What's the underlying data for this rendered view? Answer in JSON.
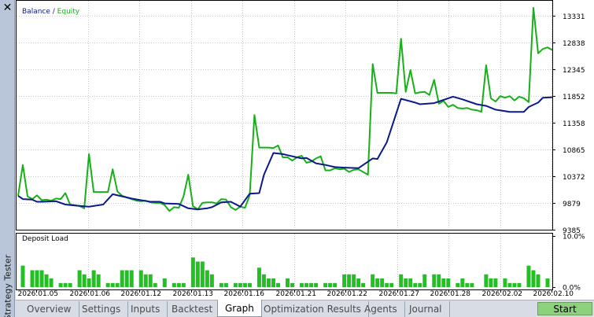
{
  "window": {
    "close_glyph": "✕",
    "side_title": "Strategy Tester"
  },
  "legend": {
    "balance": "Balance",
    "separator": " / ",
    "equity": "Equity"
  },
  "subchart_label": "Deposit Load",
  "tabs": [
    {
      "label": "Overview",
      "active": false
    },
    {
      "label": "Settings",
      "active": false
    },
    {
      "label": "Inputs",
      "active": false
    },
    {
      "label": "Backtest",
      "active": false
    },
    {
      "label": "Graph",
      "active": true
    },
    {
      "label": "Optimization Results",
      "active": false
    },
    {
      "label": "Agents",
      "active": false
    },
    {
      "label": "Journal",
      "active": false
    }
  ],
  "start_label": "Start",
  "colors": {
    "balance": "#0a1a8c",
    "equity": "#18b018",
    "deposit_load": "#22c022",
    "grid": "#c8c8c8"
  },
  "chart_data": {
    "type": "line",
    "ylim": [
      9385,
      13580
    ],
    "y_ticks": [
      9385,
      9879,
      10372,
      10865,
      11358,
      11852,
      12345,
      12838,
      13331
    ],
    "x_ticks": [
      "2026.01.05",
      "2026.01.06",
      "2026.01.12",
      "2026.01.13",
      "2026.01.16",
      "2026.01.21",
      "2026.01.22",
      "2026.01.27",
      "2026.01.28",
      "2026.02.02",
      "2026.02.10"
    ],
    "x_range": [
      0,
      113
    ],
    "series": [
      {
        "name": "Balance",
        "x": [
          0,
          1,
          3,
          4,
          5,
          8,
          10,
          12,
          15,
          18,
          20,
          22,
          24,
          26,
          28,
          30,
          31,
          34,
          36,
          38,
          40,
          41,
          43,
          45,
          47,
          49,
          51,
          52,
          54,
          56,
          57,
          60,
          61,
          63,
          65,
          67,
          69,
          72,
          75,
          76,
          78,
          81,
          84,
          85,
          88,
          90,
          92,
          94,
          97,
          99,
          101,
          104,
          107,
          108,
          110,
          111,
          113
        ],
        "values": [
          10010,
          9950,
          9940,
          9900,
          9900,
          9910,
          9850,
          9830,
          9810,
          9850,
          10040,
          10000,
          9960,
          9930,
          9900,
          9900,
          9870,
          9860,
          9780,
          9760,
          9780,
          9800,
          9890,
          9900,
          9810,
          10050,
          10060,
          10400,
          10800,
          10780,
          10760,
          10700,
          10710,
          10610,
          10580,
          10540,
          10530,
          10520,
          10700,
          10690,
          11000,
          11800,
          11730,
          11700,
          11720,
          11780,
          11840,
          11790,
          11700,
          11670,
          11600,
          11560,
          11560,
          11650,
          11730,
          11820,
          11830
        ]
      },
      {
        "name": "Equity",
        "x": [
          0,
          1,
          2,
          3,
          4,
          5,
          6,
          7,
          8,
          9,
          10,
          11,
          12,
          13,
          14,
          15,
          16,
          17,
          18,
          19,
          20,
          21,
          22,
          23,
          24,
          25,
          26,
          27,
          28,
          29,
          30,
          31,
          32,
          33,
          34,
          35,
          36,
          37,
          38,
          39,
          40,
          41,
          42,
          43,
          44,
          45,
          46,
          47,
          48,
          49,
          50,
          51,
          52,
          53,
          54,
          55,
          56,
          57,
          58,
          59,
          60,
          61,
          62,
          63,
          64,
          65,
          66,
          67,
          68,
          69,
          70,
          71,
          72,
          73,
          74,
          75,
          76,
          77,
          78,
          79,
          80,
          81,
          82,
          83,
          84,
          85,
          86,
          87,
          88,
          89,
          90,
          91,
          92,
          93,
          94,
          95,
          96,
          97,
          98,
          99,
          100,
          101,
          102,
          103,
          104,
          105,
          106,
          107,
          108,
          109,
          110,
          111,
          112,
          113
        ],
        "values": [
          10010,
          10580,
          10000,
          9950,
          10020,
          9930,
          9940,
          9920,
          9960,
          9950,
          10060,
          9850,
          9840,
          9820,
          9780,
          10780,
          10080,
          10080,
          10080,
          10080,
          10500,
          10090,
          10010,
          9980,
          9950,
          9920,
          9910,
          9920,
          9890,
          9880,
          9880,
          9840,
          9730,
          9800,
          9790,
          10000,
          10400,
          9820,
          9760,
          9880,
          9890,
          9890,
          9870,
          9950,
          9940,
          9800,
          9750,
          9810,
          9790,
          10020,
          11500,
          10900,
          10900,
          10900,
          10890,
          10940,
          10720,
          10720,
          10660,
          10720,
          10750,
          10620,
          10640,
          10700,
          10740,
          10480,
          10480,
          10520,
          10500,
          10510,
          10450,
          10490,
          10500,
          10450,
          10400,
          12440,
          11910,
          11910,
          11910,
          11910,
          11900,
          12910,
          11930,
          12330,
          11900,
          11920,
          11930,
          11870,
          12150,
          11710,
          11760,
          11650,
          11690,
          11630,
          11620,
          11630,
          11600,
          11590,
          11560,
          12420,
          11810,
          11750,
          11850,
          11820,
          11850,
          11770,
          11840,
          11810,
          11740,
          13480,
          12640,
          12720,
          12750,
          12700
        ]
      },
      {
        "name": "Deposit Load",
        "x": [
          1,
          3,
          4,
          5,
          6,
          7,
          9,
          10,
          11,
          13,
          14,
          15,
          16,
          17,
          19,
          20,
          21,
          22,
          23,
          24,
          26,
          27,
          28,
          29,
          31,
          33,
          34,
          35,
          37,
          38,
          39,
          40,
          41,
          43,
          44,
          46,
          47,
          48,
          49,
          51,
          52,
          53,
          54,
          55,
          57,
          58,
          60,
          61,
          62,
          63,
          65,
          66,
          67,
          69,
          70,
          71,
          72,
          73,
          75,
          76,
          77,
          78,
          79,
          81,
          82,
          83,
          84,
          85,
          86,
          88,
          89,
          90,
          91,
          93,
          94,
          95,
          96,
          99,
          100,
          101,
          103,
          104,
          105,
          106,
          108,
          109,
          110,
          112
        ],
        "values": [
          4.2,
          3.3,
          3.3,
          3.3,
          2.5,
          1.7,
          0.8,
          0.8,
          0.8,
          3.3,
          2.5,
          1.7,
          3.3,
          2.5,
          0.8,
          0.8,
          0.8,
          3.3,
          3.3,
          3.3,
          3.3,
          2.5,
          2.5,
          0.8,
          1.7,
          0.8,
          0.8,
          0.8,
          5.8,
          5.0,
          5.0,
          3.3,
          2.5,
          0.8,
          0.8,
          0.8,
          0.8,
          0.8,
          0.8,
          3.8,
          2.5,
          1.7,
          1.7,
          0.8,
          1.7,
          0.8,
          0.8,
          0.8,
          0.8,
          0.8,
          0.8,
          0.8,
          0.8,
          2.5,
          2.5,
          2.5,
          1.7,
          0.8,
          2.5,
          1.7,
          1.7,
          0.8,
          0.8,
          2.5,
          1.7,
          1.7,
          0.8,
          0.8,
          2.5,
          2.5,
          2.5,
          1.7,
          1.7,
          0.8,
          1.7,
          0.8,
          0.8,
          2.5,
          1.7,
          1.7,
          1.7,
          0.8,
          0.8,
          0.8,
          4.2,
          3.3,
          2.5,
          1.7
        ]
      }
    ],
    "load_ylim": [
      0,
      10
    ],
    "load_ticks": [
      "10.0%",
      "0.0%"
    ]
  }
}
